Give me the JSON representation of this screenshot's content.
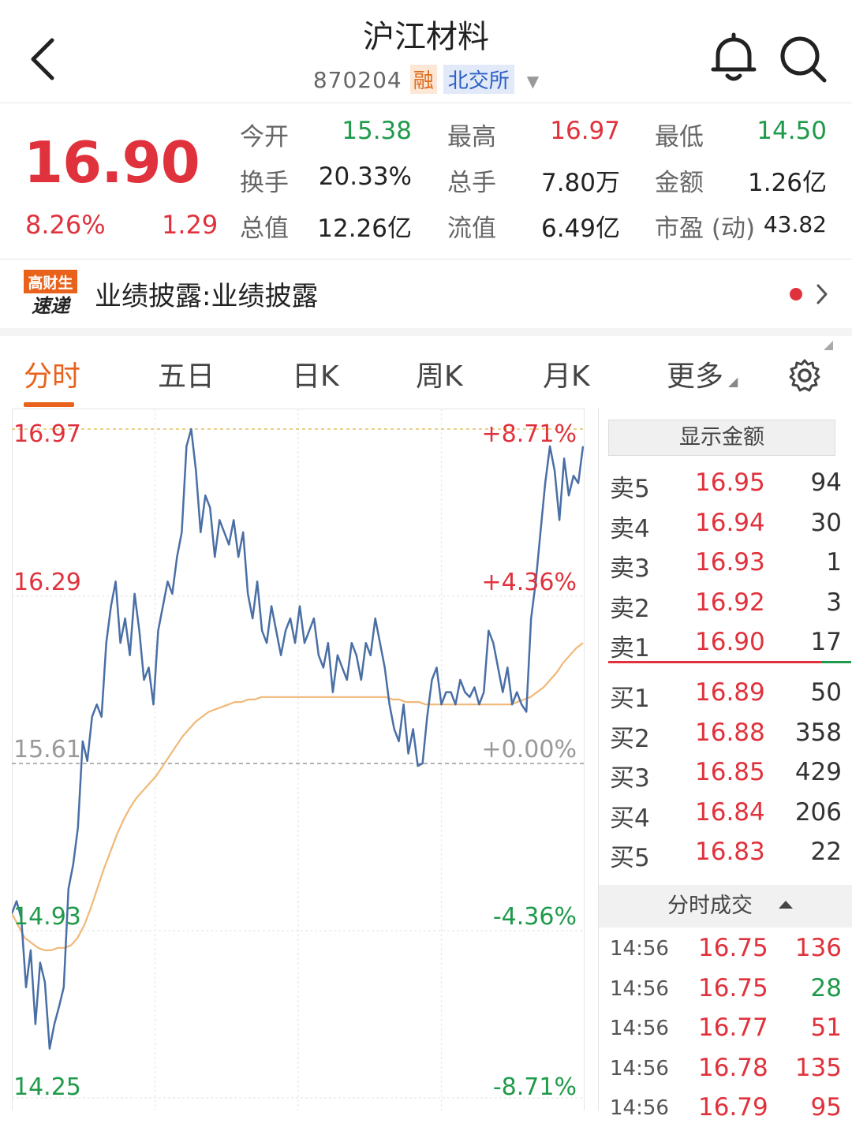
{
  "header": {
    "title": "沪江材料",
    "code": "870204",
    "margin_tag": "融",
    "exchange_tag": "北交所"
  },
  "quote": {
    "price": "16.90",
    "change_pct": "8.26%",
    "change": "1.29",
    "stats": [
      {
        "label": "今开",
        "value": "15.38",
        "color": "green"
      },
      {
        "label": "最高",
        "value": "16.97",
        "color": "red"
      },
      {
        "label": "最低",
        "value": "14.50",
        "color": "green"
      },
      {
        "label": "换手",
        "value": "20.33%",
        "color": "dark"
      },
      {
        "label": "总手",
        "value": "7.80万",
        "color": "dark"
      },
      {
        "label": "金额",
        "value": "1.26亿",
        "color": "dark"
      },
      {
        "label": "总值",
        "value": "12.26亿",
        "color": "dark"
      },
      {
        "label": "流值",
        "value": "6.49亿",
        "color": "dark"
      },
      {
        "label": "市盈 (动)",
        "value": "43.82",
        "color": "dark"
      }
    ]
  },
  "news": {
    "logo_line1": "高财生",
    "logo_line2": "速递",
    "text": "业绩披露:业绩披露"
  },
  "tabs": [
    "分时",
    "五日",
    "日K",
    "周K",
    "月K",
    "更多"
  ],
  "active_tab": 0,
  "chart_data": {
    "type": "line",
    "title": "",
    "xlabel": "",
    "ylabel": "",
    "y_left_ticks": [
      "16.97",
      "16.29",
      "15.61",
      "14.93",
      "14.25"
    ],
    "y_right_ticks": [
      "+8.71%",
      "+4.36%",
      "+0.00%",
      "-4.36%",
      "-8.71%"
    ],
    "ylim": [
      14.25,
      16.97
    ],
    "prev_close": 15.61,
    "series": [
      {
        "color": "#4a6fa5",
        "values": [
          15.0,
          15.05,
          14.98,
          14.7,
          14.85,
          14.55,
          14.8,
          14.72,
          14.45,
          14.55,
          14.62,
          14.7,
          15.1,
          15.2,
          15.35,
          15.7,
          15.62,
          15.8,
          15.85,
          15.8,
          16.1,
          16.25,
          16.35,
          16.1,
          16.2,
          16.05,
          16.3,
          16.15,
          15.95,
          16.0,
          15.85,
          16.15,
          16.25,
          16.35,
          16.3,
          16.45,
          16.55,
          16.9,
          16.97,
          16.8,
          16.55,
          16.7,
          16.65,
          16.45,
          16.6,
          16.55,
          16.5,
          16.6,
          16.45,
          16.55,
          16.3,
          16.2,
          16.35,
          16.15,
          16.1,
          16.25,
          16.15,
          16.05,
          16.15,
          16.2,
          16.1,
          16.25,
          16.1,
          16.15,
          16.2,
          16.05,
          16.0,
          16.1,
          15.9,
          16.05,
          16.0,
          15.95,
          16.1,
          16.05,
          15.95,
          16.1,
          16.05,
          16.2,
          16.1,
          16.0,
          15.85,
          15.75,
          15.7,
          15.85,
          15.65,
          15.75,
          15.6,
          15.61,
          15.8,
          15.95,
          16.0,
          15.85,
          15.9,
          15.9,
          15.85,
          15.95,
          15.9,
          15.88,
          15.92,
          15.85,
          15.9,
          16.15,
          16.1,
          16.0,
          15.9,
          16.0,
          15.85,
          15.9,
          15.85,
          15.82,
          16.2,
          16.35,
          16.55,
          16.75,
          16.9,
          16.8,
          16.6,
          16.85,
          16.7,
          16.78,
          16.75,
          16.9
        ]
      },
      {
        "color": "#f0b877",
        "values": [
          15.0,
          14.95,
          14.9,
          14.88,
          14.86,
          14.85,
          14.85,
          14.86,
          14.86,
          14.87,
          14.9,
          14.95,
          15.02,
          15.1,
          15.18,
          15.25,
          15.32,
          15.38,
          15.43,
          15.47,
          15.5,
          15.53,
          15.56,
          15.6,
          15.64,
          15.68,
          15.72,
          15.75,
          15.78,
          15.8,
          15.82,
          15.83,
          15.84,
          15.85,
          15.86,
          15.86,
          15.87,
          15.87,
          15.88,
          15.88,
          15.88,
          15.88,
          15.88,
          15.88,
          15.88,
          15.88,
          15.88,
          15.88,
          15.88,
          15.88,
          15.88,
          15.88,
          15.88,
          15.88,
          15.88,
          15.88,
          15.88,
          15.88,
          15.87,
          15.87,
          15.86,
          15.86,
          15.86,
          15.85,
          15.85,
          15.85,
          15.85,
          15.85,
          15.85,
          15.85,
          15.85,
          15.85,
          15.85,
          15.85,
          15.85,
          15.85,
          15.85,
          15.86,
          15.87,
          15.88,
          15.9,
          15.92,
          15.95,
          15.98,
          16.02,
          16.05,
          16.08,
          16.1
        ]
      }
    ]
  },
  "order_book": {
    "show_amount_label": "显示金额",
    "asks": [
      {
        "label": "卖5",
        "price": "16.95",
        "volume": "94"
      },
      {
        "label": "卖4",
        "price": "16.94",
        "volume": "30"
      },
      {
        "label": "卖3",
        "price": "16.93",
        "volume": "1"
      },
      {
        "label": "卖2",
        "price": "16.92",
        "volume": "3"
      },
      {
        "label": "卖1",
        "price": "16.90",
        "volume": "17"
      }
    ],
    "bids": [
      {
        "label": "买1",
        "price": "16.89",
        "volume": "50"
      },
      {
        "label": "买2",
        "price": "16.88",
        "volume": "358"
      },
      {
        "label": "买3",
        "price": "16.85",
        "volume": "429"
      },
      {
        "label": "买4",
        "price": "16.84",
        "volume": "206"
      },
      {
        "label": "买5",
        "price": "16.83",
        "volume": "22"
      }
    ],
    "ticks_header": "分时成交",
    "ticks": [
      {
        "time": "14:56",
        "price": "16.75",
        "volume": "136",
        "color": "red"
      },
      {
        "time": "14:56",
        "price": "16.75",
        "volume": "28",
        "color": "green"
      },
      {
        "time": "14:56",
        "price": "16.77",
        "volume": "51",
        "color": "red"
      },
      {
        "time": "14:56",
        "price": "16.78",
        "volume": "135",
        "color": "red"
      },
      {
        "time": "14:56",
        "price": "16.79",
        "volume": "95",
        "color": "red"
      }
    ]
  }
}
